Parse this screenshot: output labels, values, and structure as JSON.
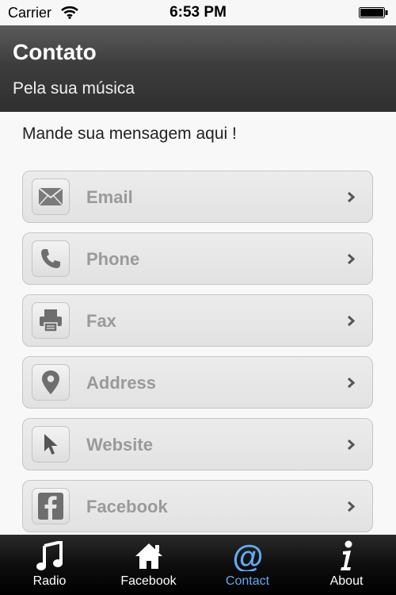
{
  "status_bar": {
    "carrier": "Carrier",
    "time": "6:53 PM"
  },
  "header": {
    "title": "Contato",
    "subtitle": "Pela sua música"
  },
  "intro": "Mande sua mensagem aqui !",
  "contacts": [
    {
      "label": "Email",
      "icon": "envelope-icon"
    },
    {
      "label": "Phone",
      "icon": "phone-icon"
    },
    {
      "label": "Fax",
      "icon": "printer-icon"
    },
    {
      "label": "Address",
      "icon": "map-pin-icon"
    },
    {
      "label": "Website",
      "icon": "cursor-arrow-icon"
    },
    {
      "label": "Facebook",
      "icon": "facebook-icon"
    }
  ],
  "tabs": [
    {
      "label": "Radio",
      "icon": "music-note-icon",
      "active": false
    },
    {
      "label": "Facebook",
      "icon": "home-icon",
      "active": false
    },
    {
      "label": "Contact",
      "icon": "at-sign-icon",
      "active": true
    },
    {
      "label": "About",
      "icon": "info-icon",
      "active": false
    }
  ],
  "colors": {
    "active_tab": "#62aaf2",
    "row_label": "#9a9a9a",
    "header_bg": "#3d3d3d"
  }
}
